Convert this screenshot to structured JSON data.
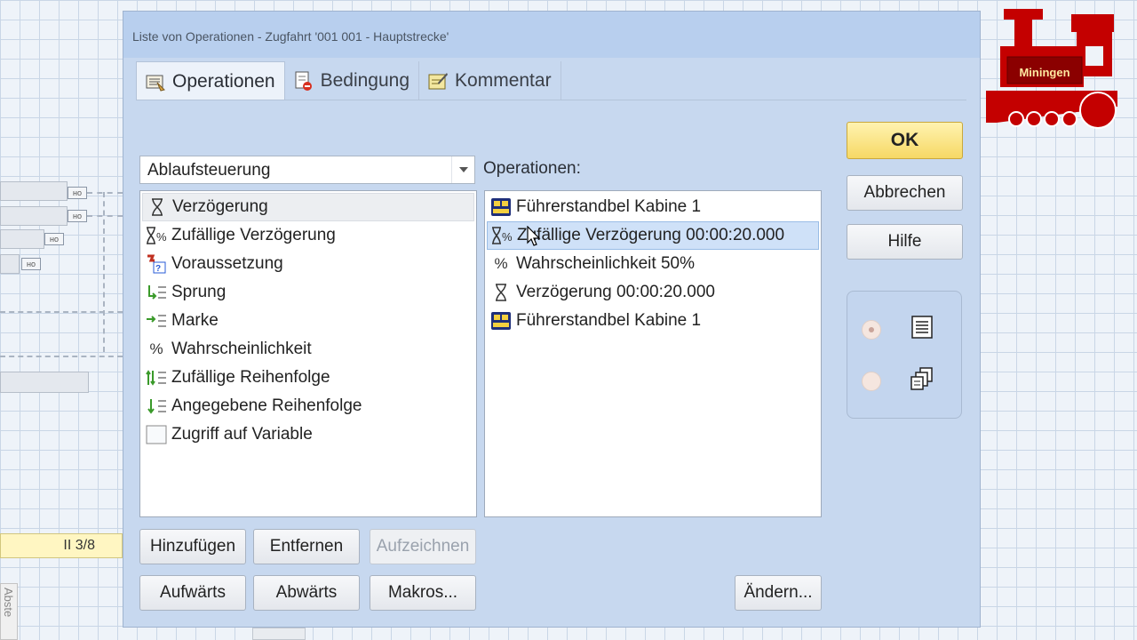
{
  "window": {
    "title": "Liste von Operationen - Zugfahrt '001 001 - Hauptstrecke'"
  },
  "tabs": [
    {
      "label": "Operationen",
      "icon": "operations-icon",
      "active": true
    },
    {
      "label": "Bedingung",
      "icon": "condition-icon",
      "active": false
    },
    {
      "label": "Kommentar",
      "icon": "comment-icon",
      "active": false
    }
  ],
  "category_select": {
    "value": "Ablaufsteuerung"
  },
  "operations_label": "Operationen:",
  "available_items": [
    {
      "label": "Verzögerung",
      "icon": "hourglass-icon",
      "selected": true
    },
    {
      "label": "Zufällige Verzögerung",
      "icon": "random-delay-icon"
    },
    {
      "label": "Voraussetzung",
      "icon": "precondition-icon"
    },
    {
      "label": "Sprung",
      "icon": "jump-icon"
    },
    {
      "label": "Marke",
      "icon": "mark-icon"
    },
    {
      "label": "Wahrscheinlichkeit",
      "icon": "percent-icon"
    },
    {
      "label": "Zufällige Reihenfolge",
      "icon": "random-order-icon"
    },
    {
      "label": "Angegebene Reihenfolge",
      "icon": "given-order-icon"
    },
    {
      "label": "Zugriff auf Variable",
      "icon": "variable-icon"
    }
  ],
  "operation_items": [
    {
      "label": "Führerstandbel Kabine 1",
      "icon": "cab-light-icon"
    },
    {
      "label": "Zufällige Verzögerung 00:00:20.000",
      "icon": "random-delay-icon",
      "selected": true
    },
    {
      "label": "Wahrscheinlichkeit 50%",
      "icon": "percent-icon"
    },
    {
      "label": "Verzögerung 00:00:20.000",
      "icon": "hourglass-icon"
    },
    {
      "label": "Führerstandbel Kabine 1",
      "icon": "cab-light-icon"
    }
  ],
  "buttons": {
    "add": "Hinzufügen",
    "remove": "Entfernen",
    "record": "Aufzeichnen",
    "up": "Aufwärts",
    "down": "Abwärts",
    "macros": "Makros...",
    "change": "Ändern...",
    "ok": "OK",
    "cancel": "Abbrechen",
    "help": "Hilfe"
  },
  "background": {
    "track_label": "II 3/8",
    "side_tab": "Abste"
  },
  "logo": {
    "text": "Miningen"
  },
  "colors": {
    "accent_ok": "#f6d865",
    "selection": "#cfe1f8",
    "logo_red": "#c40000"
  }
}
